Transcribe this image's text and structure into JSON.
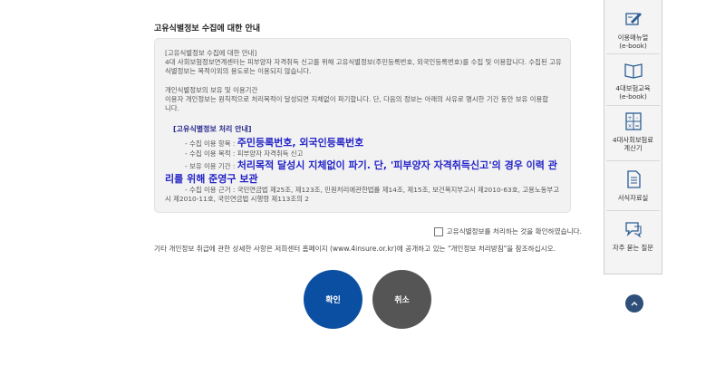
{
  "title": "고유식별정보 수집에 대한 안내",
  "notice": {
    "intro": "[고유식별정보 수집에 대한 안내]",
    "intro_body": "4대 사회보험정보연계센터는 피부양자 자격취득 신고를 위해 고유식별정보(주민등록번호, 외국인등록번호)를 수집 및 이용합니다. 수집된 고유식별정보는 목적이외의 용도로는 이용되지 않습니다.",
    "retention_head": "개인식별정보의 보유 및 이용기간",
    "retention_body": "이용자 개인정보는 원칙적으로 처리목적이 달성되면 지체없이 파기합니다. 단, 다음의 정보는 아래의 사유로 명시한 기간 동안 보유 이용합니다.",
    "proc_title": "[고유식별정보 처리 안내]",
    "items_label": "- 수집 이용 항목 : ",
    "items_value": "주민등록번호, 외국인등록번호",
    "purpose": "- 수집 이용 목적 : 피부양자 자격취득 신고",
    "period_label": "- 보유 이용 기간 : ",
    "period_value": "처리목적 달성시 지체없이 파기. 단, '피부양자 자격취득신고'의 경우 이력 관리를 위해 준영구 보관",
    "basis": "- 수집 이용 근거 : 국민연금법 제25조, 제123조, 민원처리에관한법률 제14조, 제15조, 보건복지부고시 제2010-63호, 고용노동부고시 제2010-11호, 국민연금법 시행령 제113조의 2"
  },
  "confirm_label": "고유식별정보를 처리하는 것을 확인하였습니다.",
  "other_info": "기타 개인정보 취급에 관한 상세한 사항은 저희센터 홈페이지 (www.4insure.or.kr)에 공개하고 있는 \"개인정보 처리방침\"을 참조하십시오.",
  "buttons": {
    "ok": "확인",
    "cancel": "취소"
  },
  "quick_menu": {
    "manual": "이용매뉴얼\n(e-book)",
    "edu": "4대보험교육\n(e-book)",
    "calc": "4대사회보험료\n계산기",
    "forms": "서식자료실",
    "faq": "자주 묻는 질문"
  },
  "colors": {
    "primary": "#0b4fa3",
    "secondary": "#555555",
    "emphasis": "#2323c8"
  }
}
